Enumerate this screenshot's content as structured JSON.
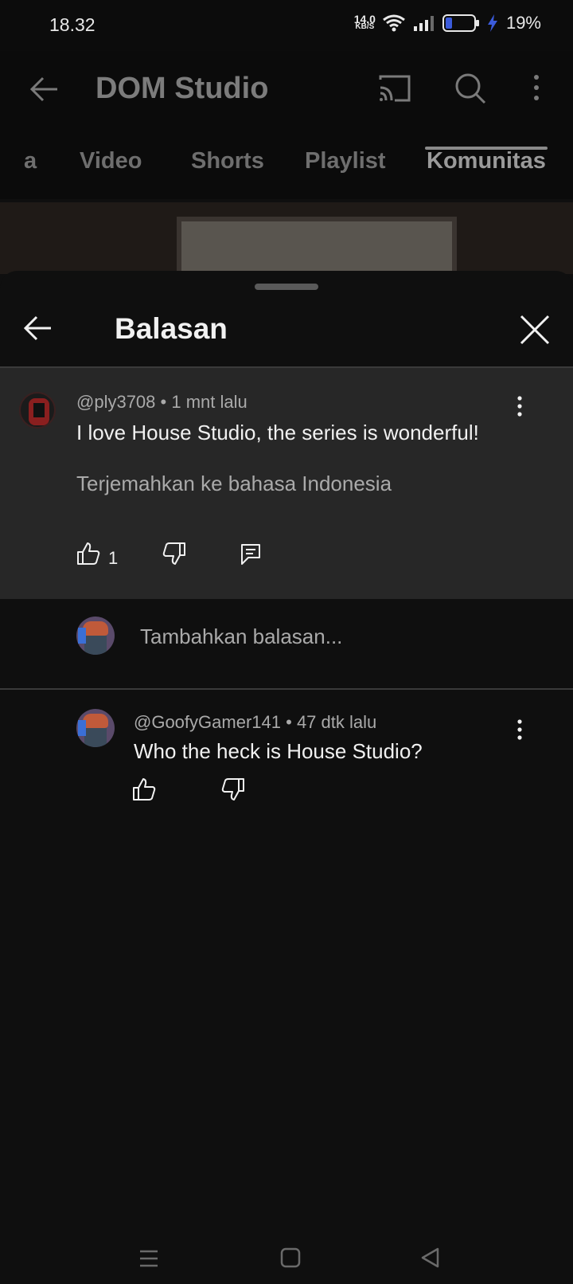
{
  "status_bar": {
    "time": "18.32",
    "net_speed_value": "14.0",
    "net_speed_unit": "KB/S",
    "battery_percent": "19%"
  },
  "header": {
    "channel_name": "DOM Studio",
    "icons": [
      "back-arrow-icon",
      "cast-icon",
      "search-icon",
      "more-vert-icon"
    ]
  },
  "tabs": [
    {
      "label": "a"
    },
    {
      "label": "Video"
    },
    {
      "label": "Shorts"
    },
    {
      "label": "Playlist"
    },
    {
      "label": "Komunitas",
      "active": true
    }
  ],
  "sheet": {
    "title": "Balasan",
    "parent_comment": {
      "author": "@ply3708",
      "time": "1 mnt lalu",
      "text": "I love House Studio, the series is wonderful!",
      "translate_label": "Terjemahkan ke bahasa Indonesia",
      "like_count": "1"
    },
    "reply_input": {
      "placeholder": "Tambahkan balasan..."
    },
    "replies": [
      {
        "author": "@GoofyGamer141",
        "time": "47 dtk lalu",
        "text": "Who the heck is House Studio?"
      }
    ]
  },
  "colors": {
    "background": "#0f0f0f",
    "highlight_comment_bg": "#272727",
    "text_primary": "#f1f1f1",
    "text_secondary": "#aaaaaa",
    "battery_charge": "#3b5bdb"
  }
}
